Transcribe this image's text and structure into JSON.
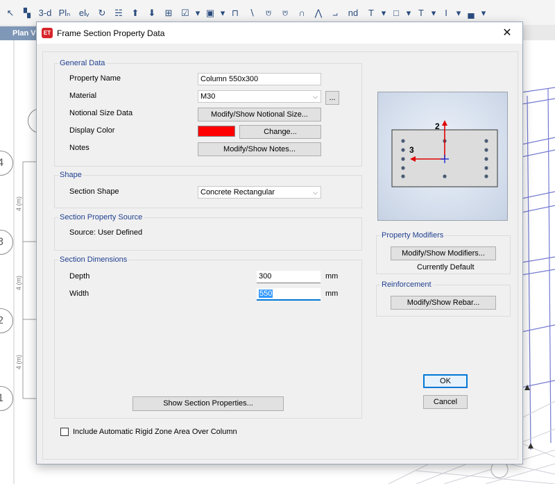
{
  "background": {
    "toolbar_icons": [
      "↖",
      "▚",
      "3-d",
      "Plₙ",
      "elᵥ",
      "↻",
      "☵",
      "⬆",
      "⬇",
      "⊞",
      "☑",
      "▾",
      "▣",
      "▾",
      "⊓",
      "∖",
      "⩅",
      "⩅",
      "∩",
      "⋀",
      "⨼",
      "nd",
      "T",
      "▾",
      "□",
      "▾",
      "T",
      "▾",
      "I",
      "▾",
      "▄",
      "▾"
    ],
    "plan_tab": "Plan Vi",
    "grid_bubbles": [
      "4",
      "3",
      "2",
      "1"
    ],
    "dimension_labels": [
      "4 (m)",
      "4 (m)",
      "4 (m)"
    ]
  },
  "dialog": {
    "title": "Frame Section Property Data",
    "app_icon_text": "ET",
    "close_icon": "close-icon",
    "general_data": {
      "title": "General Data",
      "property_name_label": "Property Name",
      "property_name_value": "Column 550x300",
      "material_label": "Material",
      "material_value": "M30",
      "material_more": "...",
      "notional_label": "Notional Size Data",
      "notional_button": "Modify/Show Notional Size...",
      "display_color_label": "Display Color",
      "display_color": "#ff0000",
      "change_button": "Change...",
      "notes_label": "Notes",
      "notes_button": "Modify/Show Notes..."
    },
    "shape": {
      "title": "Shape",
      "section_shape_label": "Section Shape",
      "section_shape_value": "Concrete Rectangular"
    },
    "source": {
      "title": "Section Property Source",
      "source_text": "Source:  User Defined"
    },
    "dimensions": {
      "title": "Section Dimensions",
      "depth_label": "Depth",
      "depth_value": "300",
      "depth_unit": "mm",
      "width_label": "Width",
      "width_value": "550",
      "width_unit": "mm"
    },
    "show_props_button": "Show Section Properties...",
    "preview": {
      "axis2_label": "2",
      "axis3_label": "3"
    },
    "property_modifiers": {
      "title": "Property Modifiers",
      "button": "Modify/Show Modifiers...",
      "status": "Currently Default"
    },
    "reinforcement": {
      "title": "Reinforcement",
      "button": "Modify/Show Rebar..."
    },
    "ok_button": "OK",
    "cancel_button": "Cancel",
    "rigid_zone_label": "Include Automatic Rigid Zone Area Over Column",
    "rigid_zone_checked": false
  }
}
